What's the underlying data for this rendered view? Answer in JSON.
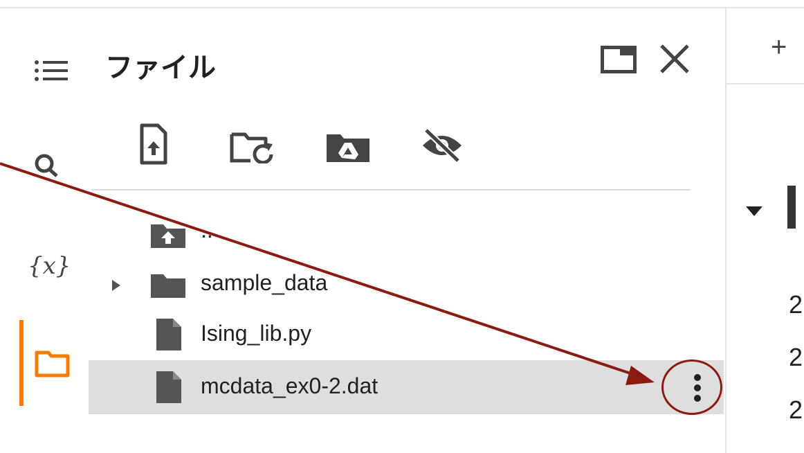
{
  "panel": {
    "title": "ファイル",
    "toolbar_icons": [
      "upload-file-icon",
      "refresh-folder-icon",
      "mount-drive-icon",
      "hide-files-icon"
    ]
  },
  "left_rail": {
    "icons": [
      "table-of-contents-icon",
      "search-icon",
      "variables-icon",
      "files-icon"
    ],
    "variables_label": "{x}"
  },
  "files": [
    {
      "name": "..",
      "icon": "parent-folder-icon"
    },
    {
      "name": "sample_data",
      "icon": "folder-icon",
      "expandable": true
    },
    {
      "name": "Ising_lib.py",
      "icon": "file-icon"
    },
    {
      "name": "mcdata_ex0-2.dat",
      "icon": "file-icon",
      "selected": true
    }
  ],
  "right_pane": {
    "add_symbol": "+",
    "lines": [
      "2",
      "2",
      "2"
    ]
  },
  "colors": {
    "accent_active": "#f57c00",
    "annotation": "#8b1a10",
    "selected_row": "#dedede"
  }
}
